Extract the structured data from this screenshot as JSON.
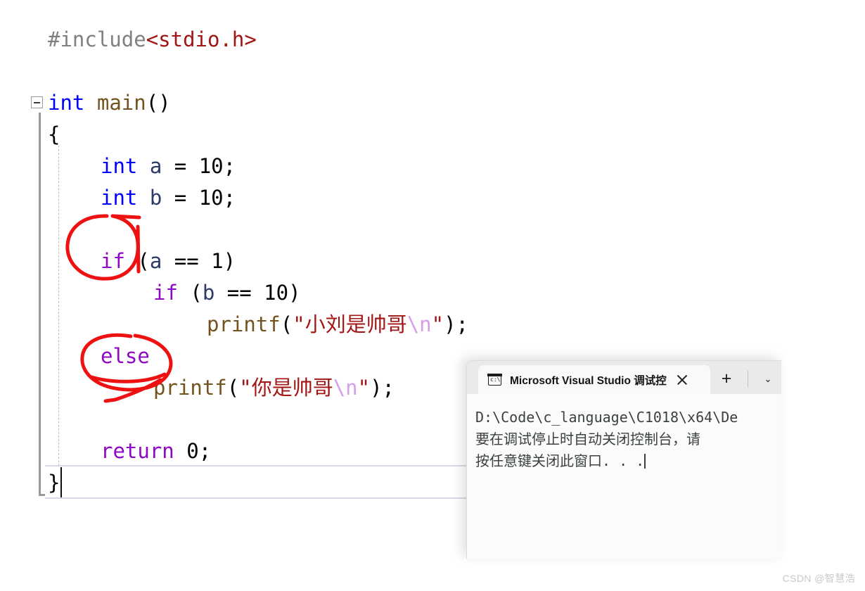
{
  "editor": {
    "name": "code-editor",
    "fold_marker": "collapse",
    "lines": [
      {
        "indent": 1,
        "segments": [
          {
            "class": "tok-pre",
            "text": "#include"
          },
          {
            "class": "tok-header",
            "text": "<stdio.h>"
          }
        ]
      },
      {
        "indent": 1,
        "segments": []
      },
      {
        "indent": 1,
        "segments": [
          {
            "class": "tok-kw",
            "text": "int"
          },
          {
            "class": "tok-punct",
            "text": " "
          },
          {
            "class": "tok-fn",
            "text": "main"
          },
          {
            "class": "tok-punct",
            "text": "()"
          }
        ]
      },
      {
        "indent": 1,
        "segments": [
          {
            "class": "tok-punct",
            "text": "{"
          }
        ]
      },
      {
        "indent": 2,
        "segments": [
          {
            "class": "tok-kw",
            "text": "int"
          },
          {
            "class": "tok-punct",
            "text": " "
          },
          {
            "class": "tok-var",
            "text": "a"
          },
          {
            "class": "tok-punct",
            "text": " = "
          },
          {
            "class": "tok-num",
            "text": "10"
          },
          {
            "class": "tok-punct",
            "text": ";"
          }
        ]
      },
      {
        "indent": 2,
        "segments": [
          {
            "class": "tok-kw",
            "text": "int"
          },
          {
            "class": "tok-punct",
            "text": " "
          },
          {
            "class": "tok-var",
            "text": "b"
          },
          {
            "class": "tok-punct",
            "text": " = "
          },
          {
            "class": "tok-num",
            "text": "10"
          },
          {
            "class": "tok-punct",
            "text": ";"
          }
        ]
      },
      {
        "indent": 2,
        "segments": []
      },
      {
        "indent": 2,
        "segments": [
          {
            "class": "tok-ctrl",
            "text": "if"
          },
          {
            "class": "tok-punct",
            "text": " ("
          },
          {
            "class": "tok-var",
            "text": "a"
          },
          {
            "class": "tok-punct",
            "text": " == "
          },
          {
            "class": "tok-num",
            "text": "1"
          },
          {
            "class": "tok-punct",
            "text": ")"
          }
        ]
      },
      {
        "indent": 3,
        "segments": [
          {
            "class": "tok-ctrl",
            "text": "if"
          },
          {
            "class": "tok-punct",
            "text": " ("
          },
          {
            "class": "tok-var",
            "text": "b"
          },
          {
            "class": "tok-punct",
            "text": " == "
          },
          {
            "class": "tok-num",
            "text": "10"
          },
          {
            "class": "tok-punct",
            "text": ")"
          }
        ]
      },
      {
        "indent": 4,
        "segments": [
          {
            "class": "tok-fn",
            "text": "printf"
          },
          {
            "class": "tok-punct",
            "text": "("
          },
          {
            "class": "tok-str",
            "text": "\"小刘是帅哥"
          },
          {
            "class": "tok-esc",
            "text": "\\n"
          },
          {
            "class": "tok-str",
            "text": "\""
          },
          {
            "class": "tok-punct",
            "text": ");"
          }
        ]
      },
      {
        "indent": 2,
        "segments": [
          {
            "class": "tok-ctrl",
            "text": "else"
          }
        ]
      },
      {
        "indent": 3,
        "segments": [
          {
            "class": "tok-fn",
            "text": "printf"
          },
          {
            "class": "tok-punct",
            "text": "("
          },
          {
            "class": "tok-str",
            "text": "\"你是帅哥"
          },
          {
            "class": "tok-esc",
            "text": "\\n"
          },
          {
            "class": "tok-str",
            "text": "\""
          },
          {
            "class": "tok-punct",
            "text": ");"
          }
        ]
      },
      {
        "indent": 2,
        "segments": []
      },
      {
        "indent": 2,
        "segments": [
          {
            "class": "tok-ctrl",
            "text": "return"
          },
          {
            "class": "tok-punct",
            "text": " "
          },
          {
            "class": "tok-num",
            "text": "0"
          },
          {
            "class": "tok-punct",
            "text": ";"
          }
        ]
      },
      {
        "indent": 1,
        "segments": [
          {
            "class": "tok-punct",
            "text": "}"
          }
        ]
      }
    ],
    "plain_text": "#include<stdio.h>\n\nint main()\n{\n    int a = 10;\n    int b = 10;\n\n    if (a == 1)\n        if (b == 10)\n            printf(\"小刘是帅哥\\n\");\n    else\n        printf(\"你是帅哥\\n\");\n\n    return 0;\n}"
  },
  "annotations": {
    "color": "#ee1111",
    "shapes": [
      {
        "name": "circle-around-if",
        "target": "if"
      },
      {
        "name": "ellipse-around-else",
        "target": "else"
      }
    ]
  },
  "console": {
    "name": "visual-studio-debug-console",
    "tab_title": "Microsoft Visual Studio 调试控",
    "tab_icon": "console-icon",
    "new_tab_label": "+",
    "dropdown_label": "⌄",
    "close_label": "×",
    "output_lines": [
      "D:\\Code\\c_language\\C1018\\x64\\De",
      "要在调试停止时自动关闭控制台，请",
      "按任意键关闭此窗口. . ."
    ]
  },
  "watermark": {
    "text": "CSDN @智慧浩"
  }
}
